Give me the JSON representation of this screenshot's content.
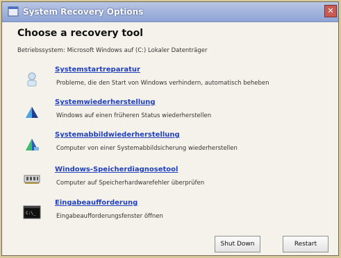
{
  "window": {
    "title": "System Recovery Options"
  },
  "heading": "Choose a recovery tool",
  "os_info": "Betriebssystem: Microsoft Windows auf (C:) Lokaler Datenträger",
  "tools": [
    {
      "label": "Systemstartreparatur",
      "description": "Probleme, die den Start von Windows verhindern, automatisch beheben",
      "icon": "startup-repair-icon"
    },
    {
      "label": "Systemwiederherstellung",
      "description": "Windows auf einen früheren Status wiederherstellen",
      "icon": "system-restore-icon"
    },
    {
      "label": "Systemabbildwiederherstellung",
      "description": "Computer von einer Systemabbildsicherung wiederherstellen",
      "icon": "system-image-icon"
    },
    {
      "label": "Windows-Speicherdiagnosetool",
      "description": "Computer auf Speicherhardwarefehler überprüfen",
      "icon": "memory-diagnostic-icon"
    },
    {
      "label": "Eingabeaufforderung",
      "description": "Eingabeaufforderungsfenster öffnen",
      "icon": "command-prompt-icon"
    }
  ],
  "buttons": {
    "shutdown": "Shut Down",
    "restart": "Restart"
  },
  "colors": {
    "link": "#1f3fbf",
    "titlebar": "#8ea4d4",
    "background": "#d7c99a"
  }
}
